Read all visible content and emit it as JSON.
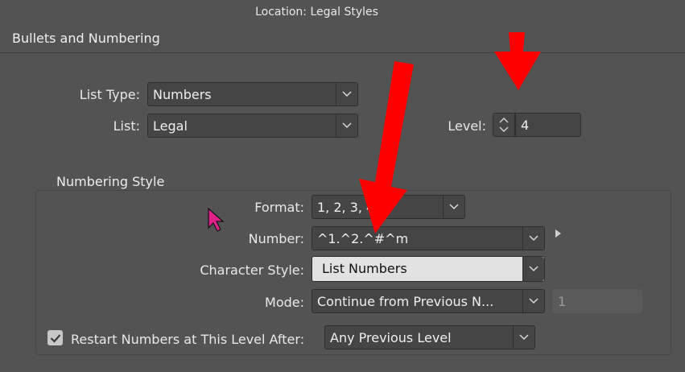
{
  "header": {
    "location_label": "Location:",
    "location_value": "Legal Styles",
    "section_title": "Bullets and Numbering"
  },
  "list_type": {
    "label": "List Type:",
    "value": "Numbers"
  },
  "list": {
    "label": "List:",
    "value": "Legal"
  },
  "level": {
    "label": "Level:",
    "value": "4"
  },
  "numbering_style": {
    "title": "Numbering Style",
    "format": {
      "label": "Format:",
      "value": "1, 2, 3, 4..."
    },
    "number": {
      "label": "Number:",
      "value": "^1.^2.^#^m"
    },
    "character_style": {
      "label": "Character Style:",
      "value": "List Numbers"
    },
    "mode": {
      "label": "Mode:",
      "value": "Continue from Previous N...",
      "start_value": "1"
    },
    "restart": {
      "label": "Restart Numbers at This Level After:",
      "checked": true,
      "value": "Any Previous Level"
    }
  },
  "annotations": {
    "arrow_color": "#ff0000",
    "cursor_color": "#e0218a"
  },
  "icons": [
    "chevron-down-icon",
    "stepper-icon",
    "triangle-right-icon",
    "checkmark-icon",
    "red-arrow",
    "mouse-cursor"
  ]
}
